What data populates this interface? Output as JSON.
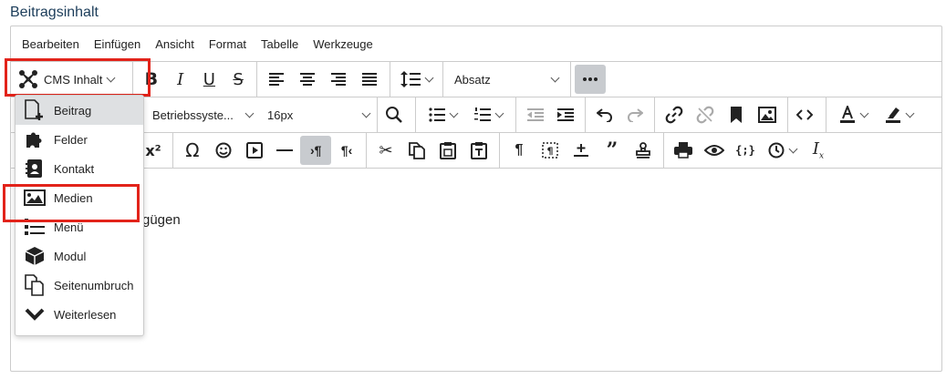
{
  "field_label": "Beitragsinhalt",
  "menubar": [
    "Bearbeiten",
    "Einfügen",
    "Ansicht",
    "Format",
    "Tabelle",
    "Werkzeuge"
  ],
  "toolbar": {
    "cms_button_label": "CMS Inhalt",
    "block_format": "Absatz",
    "font_family": "Betriebssyste...",
    "font_size": "16px"
  },
  "dropdown": {
    "items": [
      {
        "label": "Beitrag",
        "icon": "file-plus-icon"
      },
      {
        "label": "Felder",
        "icon": "puzzle-icon"
      },
      {
        "label": "Kontakt",
        "icon": "contact-card-icon"
      },
      {
        "label": "Medien",
        "icon": "image-icon"
      },
      {
        "label": "Menü",
        "icon": "list-icon"
      },
      {
        "label": "Modul",
        "icon": "cube-icon"
      },
      {
        "label": "Seitenumbruch",
        "icon": "pages-icon"
      },
      {
        "label": "Weiterlesen",
        "icon": "chevron-down-icon"
      }
    ]
  },
  "content": {
    "visible_text": "gügen"
  },
  "colors": {
    "highlight_box": "#e2231a",
    "label_color": "#1c3d5a",
    "active_button_bg": "#c8cbcf"
  }
}
